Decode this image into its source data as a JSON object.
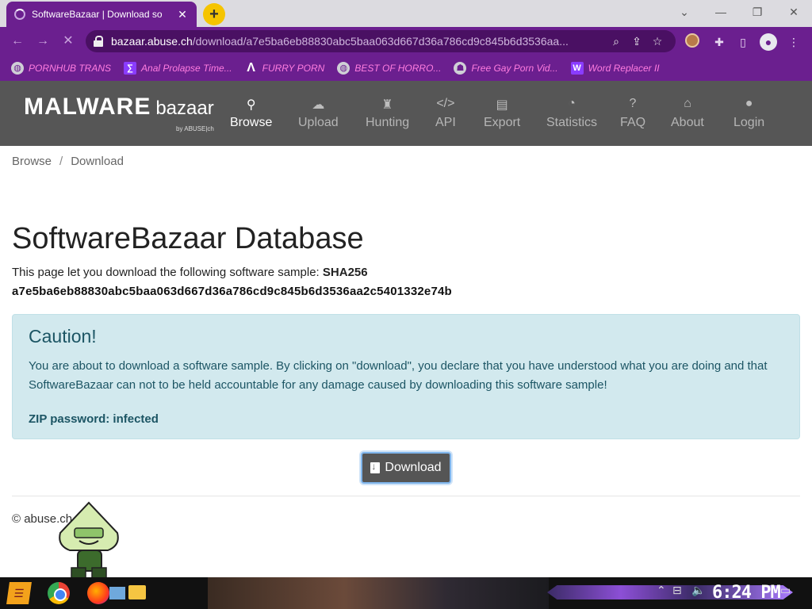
{
  "browser": {
    "tab_title": "SoftwareBazaar | Download so",
    "url_host": "bazaar.abuse.ch",
    "url_path": "/download/a7e5ba6eb88830abc5baa063d667d36a786cd9c845b6d3536aa...",
    "bookmarks": [
      {
        "label": "PORNHUB TRANS",
        "icon": "globe-icon"
      },
      {
        "label": "Anal Prolapse Time...",
        "icon": "bookmark-square-icon"
      },
      {
        "label": "FURRY PORN",
        "icon": "lambda-icon"
      },
      {
        "label": "BEST OF HORRO...",
        "icon": "globe-icon"
      },
      {
        "label": "Free Gay Porn Vid...",
        "icon": "cat-icon"
      },
      {
        "label": "Word Replacer II",
        "icon": "wr-icon"
      }
    ]
  },
  "site": {
    "logo_main": "MALWARE",
    "logo_sub": "bazaar",
    "logo_by": "by ABUSE|ch",
    "nav": [
      {
        "label": "Browse",
        "icon": "search-icon"
      },
      {
        "label": "Upload",
        "icon": "cloud-upload-icon"
      },
      {
        "label": "Hunting",
        "icon": "castle-icon"
      },
      {
        "label": "API",
        "icon": "code-icon"
      },
      {
        "label": "Export",
        "icon": "file-export-icon"
      },
      {
        "label": "Statistics",
        "icon": "pie-chart-icon"
      },
      {
        "label": "FAQ",
        "icon": "question-icon"
      },
      {
        "label": "About",
        "icon": "building-icon"
      },
      {
        "label": "Login",
        "icon": "user-icon"
      }
    ]
  },
  "breadcrumb": {
    "home": "Browse",
    "current": "Download"
  },
  "page": {
    "title": "SoftwareBazaar Database",
    "intro": "This page let you download the following software sample:",
    "hash_label": "SHA256",
    "hash_value": "a7e5ba6eb88830abc5baa063d667d36a786cd9c845b6d3536aa2c5401332e74b",
    "caution_title": "Caution!",
    "caution_text": "You are about to download a software sample. By clicking on \"download\", you declare that you have understood what you are doing and that SoftwareBazaar can not to be held accountable for any damage caused by downloading this software sample!",
    "zip_password": "ZIP password: infected",
    "download_label": "Download",
    "footer": "© abuse.ch"
  },
  "taskbar": {
    "clock": "6:24 PM"
  },
  "colors": {
    "browser_purple": "#6b1f8f",
    "header_gray": "#565656",
    "caution_bg": "#d2e9ee",
    "caution_text": "#1c5564",
    "bookmark_pink": "#ff7de0"
  }
}
